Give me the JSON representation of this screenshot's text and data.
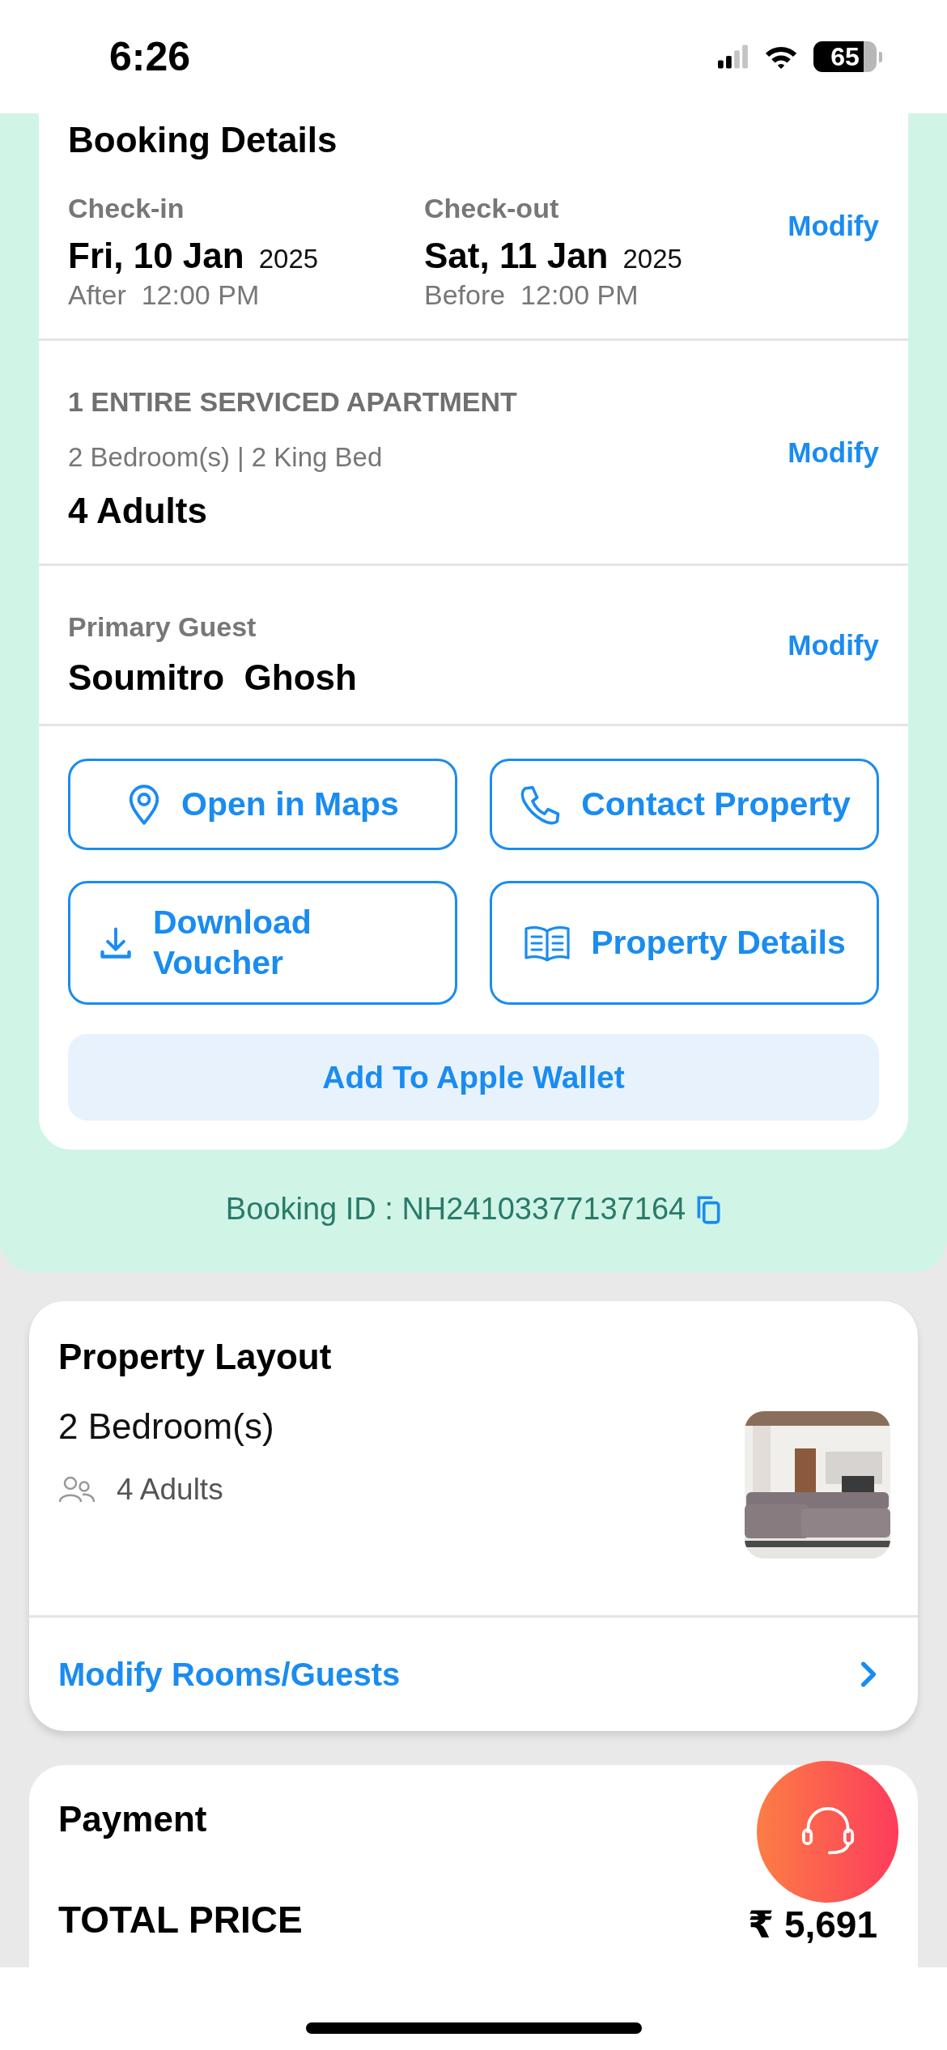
{
  "status_bar": {
    "time": "6:26",
    "battery": "65"
  },
  "booking_details": {
    "title": "Booking Details",
    "modify": "Modify",
    "stays": [
      {
        "label": "Check-in",
        "date": "Fri, 10 Jan",
        "year": "2025",
        "time": "After  12:00 PM"
      },
      {
        "label": "Check-out",
        "date": "Sat, 11 Jan",
        "year": "2025",
        "time": "Before  12:00 PM"
      }
    ]
  },
  "room": {
    "type": "1 ENTIRE SERVICED APARTMENT",
    "beds": "2 Bedroom(s) | 2 King Bed",
    "guests": "4 Adults",
    "modify": "Modify"
  },
  "primary_guest": {
    "label": "Primary Guest",
    "name": "Soumitro  Ghosh",
    "modify": "Modify"
  },
  "actions": [
    {
      "kind": "map",
      "label": "Open in Maps"
    },
    {
      "kind": "phone",
      "label": "Contact Property"
    },
    {
      "kind": "download",
      "label": "Download Voucher"
    },
    {
      "kind": "book",
      "label": "Property Details"
    }
  ],
  "wallet_button": "Add To Apple Wallet",
  "booking_id": "Booking ID : NH24103377137164",
  "property_layout": {
    "title": "Property Layout",
    "rooms": "2 Bedroom(s)",
    "guests": "4 Adults",
    "link": "Modify Rooms/Guests"
  },
  "payment": {
    "title": "Payment",
    "total_label": "TOTAL PRICE",
    "total": "₹ 5,691"
  }
}
